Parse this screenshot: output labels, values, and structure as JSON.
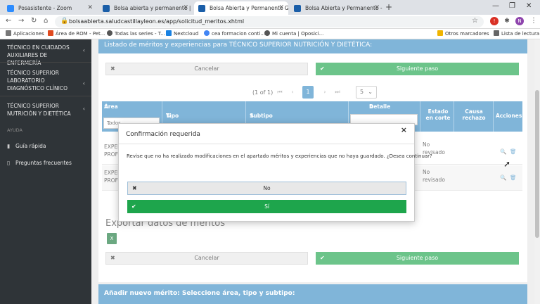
{
  "browser": {
    "tabs": [
      {
        "title": "Posasistente - Zoom",
        "active": false,
        "color": "#2d8cff"
      },
      {
        "title": "Bolsa abierta y permanente | Pro",
        "active": false,
        "color": "#1a5ea8"
      },
      {
        "title": "Bolsa Abierta y Permanente Ges",
        "active": true,
        "color": "#1a5ea8"
      },
      {
        "title": "Bolsa Abierta y Permanente - Alt",
        "active": false,
        "color": "#1a5ea8"
      }
    ],
    "url": "bolsaabierta.saludcastillayleon.es/app/solicitud_meritos.xhtml",
    "profile_initial": "N",
    "bookmarks": [
      {
        "label": "Aplicaciones",
        "color": "#777"
      },
      {
        "label": "Área de ROM - Pet...",
        "color": "#e04a1f"
      },
      {
        "label": "Todas las series - T...",
        "color": "#555"
      },
      {
        "label": "Nextcloud",
        "color": "#1a82e2"
      },
      {
        "label": "cea formacion conti...",
        "color": "#4285f4"
      },
      {
        "label": "Mi cuenta | Oposici...",
        "color": "#555"
      }
    ],
    "other_bookmarks": "Otros marcadores",
    "reading_list": "Lista de lectura"
  },
  "sidebar": {
    "items": [
      {
        "label": "TÉCNICO EN CUIDADOS AUXILIARES DE ENFERMERÍA"
      },
      {
        "label": "TÉCNICO SUPERIOR LABORATORIO DIAGNÓSTICO CLÍNICO"
      },
      {
        "label": "TÉCNICO SUPERIOR NUTRICIÓN Y DIETÉTICA"
      }
    ],
    "section": "AYUDA",
    "help": [
      {
        "label": "Guía rápida"
      },
      {
        "label": "Preguntas frecuentes"
      }
    ]
  },
  "main": {
    "panel_title": "Listado de méritos y experiencias para TÉCNICO SUPERIOR NUTRICIÓN Y DIETÉTICA:",
    "cancel_label": "Cancelar",
    "next_label": "Siguiente paso",
    "pager_text": "(1 of 1)",
    "current_page": "1",
    "page_size": "5",
    "columns": {
      "area": "Área",
      "tipo": "Tipo",
      "subtipo": "Subtipo",
      "detalle": "Detalle",
      "estado": "Estado en corte",
      "causa": "Causa rechazo",
      "acciones": "Acciones"
    },
    "area_filter": "Todos",
    "rows": [
      {
        "area": "EXPER\nPROF",
        "estado": "No revisado"
      },
      {
        "area": "EXPER\nPROF",
        "estado": "No revisado"
      }
    ],
    "export_title": "Exportar datos de méritos",
    "add_title": "Añadir nuevo mérito: Seleccione área, tipo y subtipo:"
  },
  "modal": {
    "title": "Confirmación requerida",
    "message": "Revise que no ha realizado modificaciones en el apartado méritos y experiencias que no haya guardado. ¿Desea continuar?",
    "no_label": "No",
    "yes_label": "Sí"
  },
  "colors": {
    "primary": "#3d8ec5",
    "success": "#1ea54c",
    "sidebar": "#2f3438"
  }
}
